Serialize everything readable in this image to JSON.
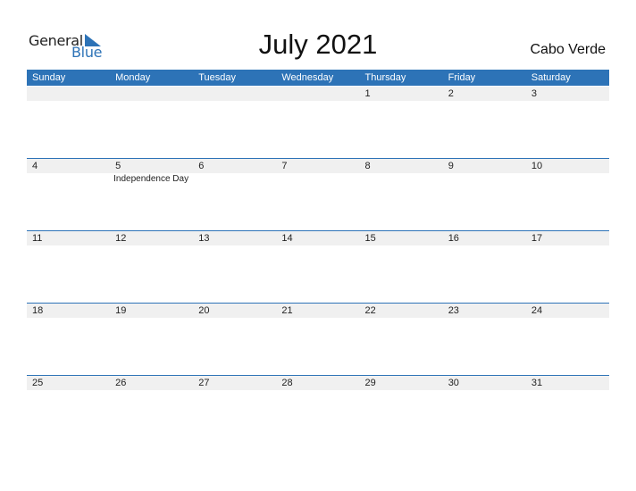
{
  "logo": {
    "general": "General",
    "blue": "Blue"
  },
  "title": "July 2021",
  "country": "Cabo Verde",
  "colors": {
    "accent": "#2d73b7",
    "strip": "#f0f0f0"
  },
  "weekdays": [
    "Sunday",
    "Monday",
    "Tuesday",
    "Wednesday",
    "Thursday",
    "Friday",
    "Saturday"
  ],
  "weeks": [
    {
      "days": [
        "",
        "",
        "",
        "",
        "1",
        "2",
        "3"
      ],
      "events": [
        "",
        "",
        "",
        "",
        "",
        "",
        ""
      ]
    },
    {
      "days": [
        "4",
        "5",
        "6",
        "7",
        "8",
        "9",
        "10"
      ],
      "events": [
        "",
        "Independence Day",
        "",
        "",
        "",
        "",
        ""
      ]
    },
    {
      "days": [
        "11",
        "12",
        "13",
        "14",
        "15",
        "16",
        "17"
      ],
      "events": [
        "",
        "",
        "",
        "",
        "",
        "",
        ""
      ]
    },
    {
      "days": [
        "18",
        "19",
        "20",
        "21",
        "22",
        "23",
        "24"
      ],
      "events": [
        "",
        "",
        "",
        "",
        "",
        "",
        ""
      ]
    },
    {
      "days": [
        "25",
        "26",
        "27",
        "28",
        "29",
        "30",
        "31"
      ],
      "events": [
        "",
        "",
        "",
        "",
        "",
        "",
        ""
      ]
    }
  ]
}
